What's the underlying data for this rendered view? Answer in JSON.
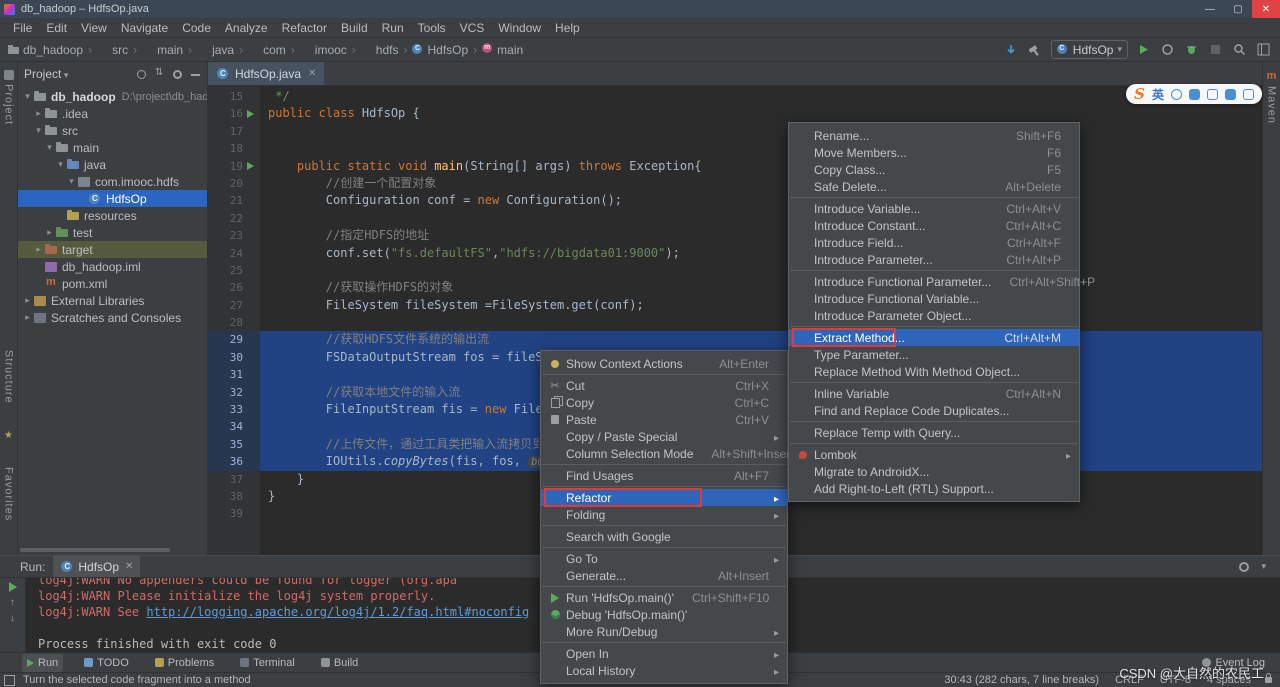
{
  "colors": {
    "selection_blue": "#2f65b8",
    "code_selection": "#214283",
    "annotation_red": "#e53935",
    "keyword_orange": "#cc7832",
    "string_green": "#6a8759",
    "link_blue": "#5f9bd6",
    "stderr_red": "#cf6b68"
  },
  "glyphs": {
    "min": "—",
    "max": "▢",
    "close": "✕",
    "tab_close": "✕",
    "combo_arrow": "▾",
    "up": "↑",
    "down": "↓",
    "collapse": "▾"
  },
  "titlebar": {
    "title": "db_hadoop – HdfsOp.java"
  },
  "menubar": {
    "items": [
      {
        "label": "File"
      },
      {
        "label": "Edit"
      },
      {
        "label": "View"
      },
      {
        "label": "Navigate"
      },
      {
        "label": "Code"
      },
      {
        "label": "Analyze"
      },
      {
        "label": "Refactor"
      },
      {
        "label": "Build"
      },
      {
        "label": "Run"
      },
      {
        "label": "Tools"
      },
      {
        "label": "VCS"
      },
      {
        "label": "Window"
      },
      {
        "label": "Help"
      }
    ]
  },
  "navbar": {
    "breadcrumb": [
      {
        "label": "db_hadoop",
        "icon": "folder"
      },
      {
        "label": "src"
      },
      {
        "label": "main"
      },
      {
        "label": "java"
      },
      {
        "label": "com"
      },
      {
        "label": "imooc"
      },
      {
        "label": "hdfs"
      },
      {
        "label": "HdfsOp",
        "icon": "class"
      },
      {
        "label": "main",
        "icon": "method"
      }
    ],
    "run_config": "HdfsOp"
  },
  "side": {
    "left_top": "Project",
    "left_bottom_1": "Structure",
    "left_bottom_2": "Favorites",
    "right_top": "Maven"
  },
  "project_panel": {
    "title": "Project",
    "items": [
      {
        "label": "db_hadoop",
        "hint": "D:\\project\\db_had",
        "indent": 0,
        "icon": "project",
        "chev": "down",
        "bold": true
      },
      {
        "label": ".idea",
        "indent": 1,
        "icon": "folder",
        "chev": "right"
      },
      {
        "label": "src",
        "indent": 1,
        "icon": "folder",
        "chev": "down"
      },
      {
        "label": "main",
        "indent": 2,
        "icon": "folder",
        "chev": "down"
      },
      {
        "label": "java",
        "indent": 3,
        "icon": "src",
        "chev": "down"
      },
      {
        "label": "com.imooc.hdfs",
        "indent": 4,
        "icon": "package",
        "chev": "down"
      },
      {
        "label": "HdfsOp",
        "indent": 5,
        "icon": "class",
        "selected": true
      },
      {
        "label": "resources",
        "indent": 3,
        "icon": "res"
      },
      {
        "label": "test",
        "indent": 2,
        "icon": "test",
        "chev": "right"
      },
      {
        "label": "target",
        "indent": 1,
        "icon": "folderx",
        "chev": "right",
        "target": true
      },
      {
        "label": "db_hadoop.iml",
        "indent": 1,
        "icon": "iml"
      },
      {
        "label": "pom.xml",
        "indent": 1,
        "icon": "maven"
      },
      {
        "label": "External Libraries",
        "indent": 0,
        "icon": "lib",
        "chev": "right"
      },
      {
        "label": "Scratches and Consoles",
        "indent": 0,
        "icon": "scratch",
        "chev": "right"
      }
    ]
  },
  "editor": {
    "tab": "HdfsOp.java",
    "lines": [
      {
        "n": "15",
        "tokens": [
          {
            "t": " */",
            "c": "doc"
          }
        ]
      },
      {
        "n": "16",
        "run": true,
        "tokens": [
          {
            "t": "public class ",
            "c": "kw"
          },
          {
            "t": "HdfsOp {",
            "c": "pl"
          }
        ]
      },
      {
        "n": "17",
        "tokens": []
      },
      {
        "n": "18",
        "tokens": []
      },
      {
        "n": "19",
        "run": true,
        "tokens": [
          {
            "t": "    ",
            "c": "pl"
          },
          {
            "t": "public static void ",
            "c": "kw"
          },
          {
            "t": "main",
            "c": "fn"
          },
          {
            "t": "(String[] args) ",
            "c": "pl"
          },
          {
            "t": "throws ",
            "c": "kw"
          },
          {
            "t": "Exception{",
            "c": "pl"
          }
        ]
      },
      {
        "n": "20",
        "tokens": [
          {
            "t": "        ",
            "c": "pl"
          },
          {
            "t": "//创建一个配置对象",
            "c": "cm"
          }
        ]
      },
      {
        "n": "21",
        "tokens": [
          {
            "t": "        Configuration conf = ",
            "c": "pl"
          },
          {
            "t": "new ",
            "c": "kw"
          },
          {
            "t": "Configuration();",
            "c": "pl"
          }
        ]
      },
      {
        "n": "22",
        "tokens": []
      },
      {
        "n": "23",
        "tokens": [
          {
            "t": "        ",
            "c": "pl"
          },
          {
            "t": "//指定HDFS的地址",
            "c": "cm"
          }
        ]
      },
      {
        "n": "24",
        "tokens": [
          {
            "t": "        conf.set(",
            "c": "pl"
          },
          {
            "t": "\"fs.defaultFS\"",
            "c": "str"
          },
          {
            "t": ",",
            "c": "pl"
          },
          {
            "t": "\"hdfs://bigdata01:9000\"",
            "c": "str"
          },
          {
            "t": ");",
            "c": "pl"
          }
        ]
      },
      {
        "n": "25",
        "tokens": []
      },
      {
        "n": "26",
        "tokens": [
          {
            "t": "        ",
            "c": "pl"
          },
          {
            "t": "//获取操作HDFS的对象",
            "c": "cm"
          }
        ]
      },
      {
        "n": "27",
        "tokens": [
          {
            "t": "        FileSystem fileSystem =FileSystem.get(conf);",
            "c": "pl"
          }
        ]
      },
      {
        "n": "28",
        "tokens": []
      },
      {
        "n": "29",
        "sel": true,
        "tokens": [
          {
            "t": "        ",
            "c": "pl"
          },
          {
            "t": "//获取HDFS文件系统的输出流",
            "c": "cm"
          }
        ]
      },
      {
        "n": "30",
        "sel": true,
        "cur": true,
        "tokens": [
          {
            "t": "        FSDataOutputStream fos = fileSyste",
            "c": "pl"
          }
        ]
      },
      {
        "n": "31",
        "sel": true,
        "tokens": []
      },
      {
        "n": "32",
        "sel": true,
        "tokens": [
          {
            "t": "        ",
            "c": "pl"
          },
          {
            "t": "//获取本地文件的输入流",
            "c": "cm"
          }
        ]
      },
      {
        "n": "33",
        "sel": true,
        "tokens": [
          {
            "t": "        FileInputStream fis = ",
            "c": "pl"
          },
          {
            "t": "new ",
            "c": "kw"
          },
          {
            "t": "FileInpu",
            "c": "pl"
          }
        ]
      },
      {
        "n": "34",
        "sel": true,
        "tokens": []
      },
      {
        "n": "35",
        "sel": true,
        "tokens": [
          {
            "t": "        ",
            "c": "pl"
          },
          {
            "t": "//上传文件，通过工具类把输入流拷贝到输出流",
            "c": "cm"
          }
        ]
      },
      {
        "n": "36",
        "sel": true,
        "tokens": [
          {
            "t": "        IOUtils.",
            "c": "pl"
          },
          {
            "t": "copyBytes",
            "c": "mi"
          },
          {
            "t": "(fis, fos, ",
            "c": "pl"
          },
          {
            "t": "buffSize: ",
            "c": "hint"
          },
          {
            "t": "1",
            "c": "num"
          }
        ]
      },
      {
        "n": "37",
        "tokens": [
          {
            "t": "    }",
            "c": "pl"
          }
        ]
      },
      {
        "n": "38",
        "tokens": [
          {
            "t": "}",
            "c": "pl"
          }
        ]
      },
      {
        "n": "39",
        "tokens": []
      }
    ]
  },
  "context_menu": {
    "items": [
      {
        "label": "Show Context Actions",
        "shortcut": "Alt+Enter",
        "icon": "bulb"
      },
      {
        "sep": true
      },
      {
        "label": "Cut",
        "shortcut": "Ctrl+X",
        "icon": "cut"
      },
      {
        "label": "Copy",
        "shortcut": "Ctrl+C",
        "icon": "copy"
      },
      {
        "label": "Paste",
        "shortcut": "Ctrl+V",
        "icon": "paste"
      },
      {
        "label": "Copy / Paste Special",
        "submenu": true
      },
      {
        "label": "Column Selection Mode",
        "shortcut": "Alt+Shift+Insert"
      },
      {
        "sep": true
      },
      {
        "label": "Find Usages",
        "shortcut": "Alt+F7"
      },
      {
        "sep": true
      },
      {
        "label": "Refactor",
        "submenu": true,
        "highlighted": true,
        "redbox": true,
        "ann_w": 158
      },
      {
        "label": "Folding",
        "submenu": true
      },
      {
        "sep": true
      },
      {
        "label": "Search with Google"
      },
      {
        "sep": true
      },
      {
        "label": "Go To",
        "submenu": true
      },
      {
        "label": "Generate...",
        "shortcut": "Alt+Insert"
      },
      {
        "sep": true
      },
      {
        "label": "Run 'HdfsOp.main()'",
        "shortcut": "Ctrl+Shift+F10",
        "icon": "run"
      },
      {
        "label": "Debug 'HdfsOp.main()'",
        "icon": "debug"
      },
      {
        "label": "More Run/Debug",
        "submenu": true
      },
      {
        "sep": true
      },
      {
        "label": "Open In",
        "submenu": true
      },
      {
        "label": "Local History",
        "submenu": true
      }
    ]
  },
  "refactor_menu": {
    "items": [
      {
        "label": "Rename...",
        "shortcut": "Shift+F6"
      },
      {
        "label": "Move Members...",
        "shortcut": "F6"
      },
      {
        "label": "Copy Class...",
        "shortcut": "F5"
      },
      {
        "label": "Safe Delete...",
        "shortcut": "Alt+Delete"
      },
      {
        "sep": true
      },
      {
        "label": "Introduce Variable...",
        "shortcut": "Ctrl+Alt+V"
      },
      {
        "label": "Introduce Constant...",
        "shortcut": "Ctrl+Alt+C"
      },
      {
        "label": "Introduce Field...",
        "shortcut": "Ctrl+Alt+F"
      },
      {
        "label": "Introduce Parameter...",
        "shortcut": "Ctrl+Alt+P"
      },
      {
        "sep": true
      },
      {
        "label": "Introduce Functional Parameter...",
        "shortcut": "Ctrl+Alt+Shift+P"
      },
      {
        "label": "Introduce Functional Variable..."
      },
      {
        "label": "Introduce Parameter Object..."
      },
      {
        "sep": true
      },
      {
        "label": "Extract Method...",
        "shortcut": "Ctrl+Alt+M",
        "highlighted": true,
        "redbox": true,
        "ann_w": 104
      },
      {
        "label": "Type Parameter..."
      },
      {
        "label": "Replace Method With Method Object..."
      },
      {
        "sep": true
      },
      {
        "label": "Inline Variable",
        "shortcut": "Ctrl+Alt+N"
      },
      {
        "label": "Find and Replace Code Duplicates..."
      },
      {
        "sep": true
      },
      {
        "label": "Replace Temp with Query..."
      },
      {
        "sep": true
      },
      {
        "label": "Lombok",
        "submenu": true,
        "icon": "lombok"
      },
      {
        "label": "Migrate to AndroidX..."
      },
      {
        "label": "Add Right-to-Left (RTL) Support..."
      }
    ]
  },
  "run_panel": {
    "label": "Run:",
    "tab": "HdfsOp",
    "output": [
      {
        "text": "log4j:WARN No appenders could be found for logger (org.apa",
        "cls": "err",
        "clip": true
      },
      {
        "text": "log4j:WARN Please initialize the log4j system properly.",
        "cls": "err"
      },
      {
        "text": "log4j:WARN See ",
        "cls": "err",
        "link": "http://logging.apache.org/log4j/1.2/faq.html#noconfig"
      },
      {
        "text": "",
        "cls": "out"
      },
      {
        "text": "Process finished with exit code 0",
        "cls": "out"
      }
    ]
  },
  "bottom_bar": {
    "left": [
      {
        "label": "Run",
        "icon": "run",
        "active": true
      },
      {
        "label": "TODO",
        "icon": "todo"
      },
      {
        "label": "Problems",
        "icon": "problems"
      },
      {
        "label": "Terminal",
        "icon": "terminal"
      },
      {
        "label": "Build",
        "icon": "build"
      }
    ],
    "right": [
      {
        "label": "Event Log"
      }
    ]
  },
  "status_bar": {
    "message": "Turn the selected code fragment into a method",
    "items": [
      {
        "label": "30:43 (282 chars, 7 line breaks)"
      },
      {
        "label": "CRLF"
      },
      {
        "label": "UTF-8"
      },
      {
        "label": "4 spaces"
      }
    ]
  },
  "watermark": "CSDN @大自然的农民工",
  "ime": {
    "logo": "S",
    "lang": "英"
  }
}
